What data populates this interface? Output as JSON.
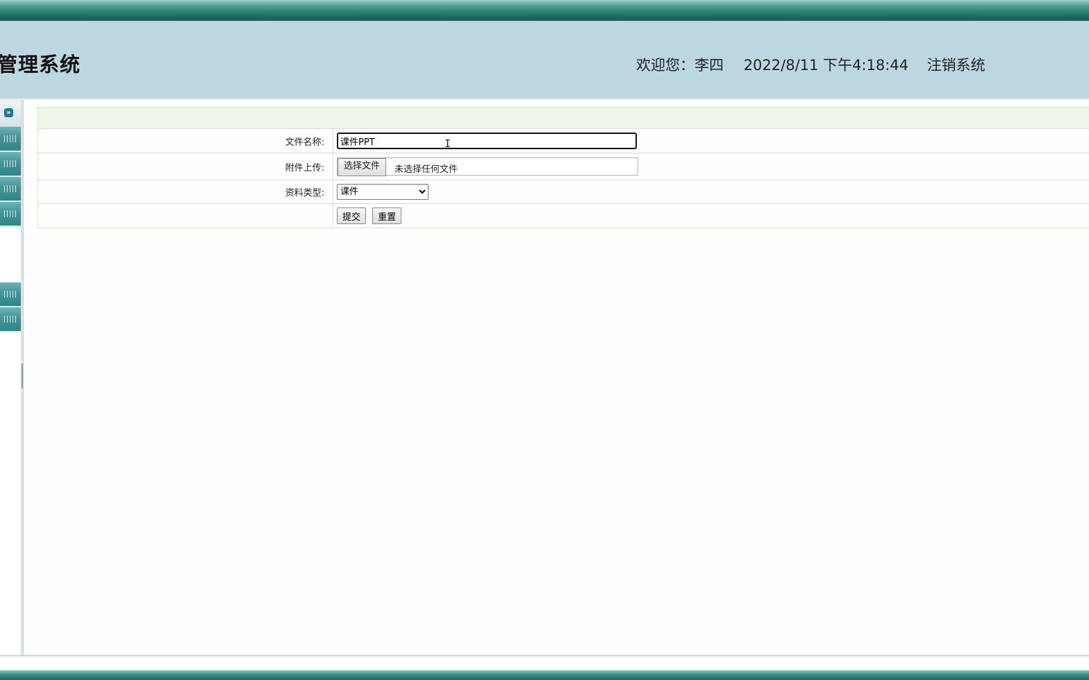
{
  "header": {
    "system_title": "管理系统",
    "welcome": "欢迎您：李四",
    "datetime": "2022/8/11 下午4:18:44",
    "logout_label": "注销系统"
  },
  "sidebar": {
    "toggle_icon": "double-chevron-down-icon",
    "item_count": 6
  },
  "form": {
    "name_label": "文件名称:",
    "name_value": "课件PPT",
    "upload_label": "附件上传:",
    "file_button_label": "选择文件",
    "file_status": "未选择任何文件",
    "type_label": "资料类型:",
    "type_selected": "课件",
    "submit_label": "提交",
    "reset_label": "重置"
  },
  "colors": {
    "header_bg": "#bcd6e2",
    "accent_teal": "#1d7466",
    "form_header_bg": "#eef6e9"
  }
}
